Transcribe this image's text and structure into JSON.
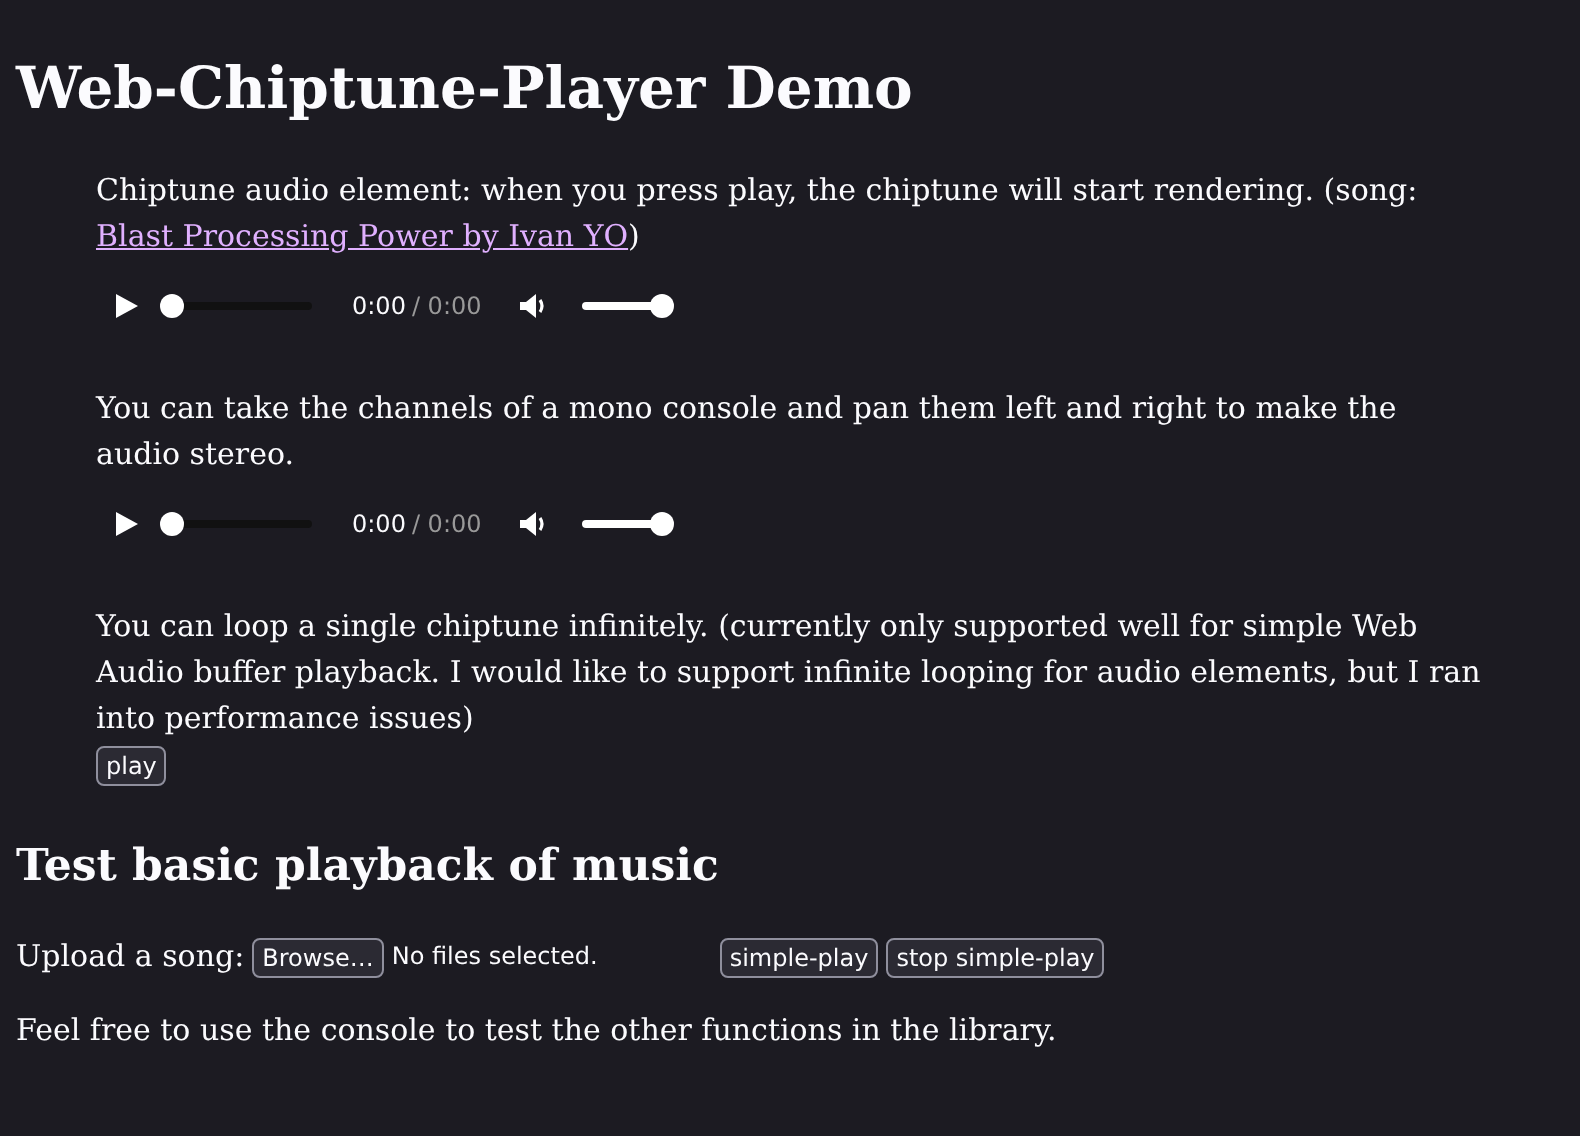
{
  "title": "Web-Chiptune-Player Demo",
  "sections": [
    {
      "kind": "audio",
      "text": "Chiptune audio element: when you press play, the chiptune will start rendering. (song: ",
      "link": "Blast Processing Power by Ivan YO",
      "after": ")",
      "player": {
        "position": "0:00",
        "duration": "/ 0:00",
        "seek": {
          "level": 0
        },
        "volume": {
          "level": 1
        }
      }
    },
    {
      "kind": "audio",
      "text": "You can take the channels of a mono console and pan them left and right to make the audio stereo.",
      "player": {
        "position": "0:00",
        "duration": "/ 0:00",
        "seek": {
          "level": 0
        },
        "volume": {
          "level": 1
        }
      }
    },
    {
      "kind": "button",
      "text": "You can loop a single chiptune infinitely. (currently only supported well for simple Web Audio buffer playback. I would like to support infinite looping for audio elements, but I ran into performance issues)",
      "button": "play"
    }
  ],
  "heading": "Test basic playback of music",
  "upload": {
    "label": "Upload a song:",
    "browse": "Browse…",
    "status": "No files selected.",
    "buttons": [
      "simple-play",
      "stop simple-play"
    ]
  },
  "footer": "Feel free to use the console to test the other functions in the library."
}
